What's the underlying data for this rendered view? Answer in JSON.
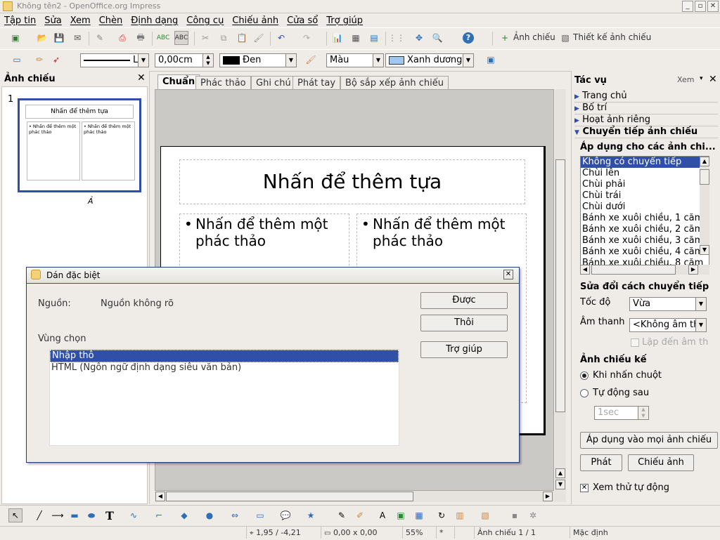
{
  "window": {
    "title": "Không tên2 - OpenOffice.org Impress"
  },
  "menu": [
    "Tập tin",
    "Sửa",
    "Xem",
    "Chèn",
    "Định dạng",
    "Công cụ",
    "Chiếu ảnh",
    "Cửa sổ",
    "Trợ giúp"
  ],
  "toolbar1": {
    "slideshow_label": "Ảnh chiếu",
    "design_label": "Thiết kế ảnh chiếu"
  },
  "toolbar2": {
    "line_style": "L",
    "line_width": "0,00cm",
    "line_color": "Đen",
    "area_style": "Màu",
    "area_color": "Xanh dương"
  },
  "slides_panel": {
    "title": "Ảnh chiếu",
    "slide_number": "1",
    "thumb_title": "Nhấn để thêm tựa",
    "thumb_outline": "• Nhấn để thêm một phác thảo",
    "thumb_caption": "Ả"
  },
  "tabs": [
    "Chuẩn",
    "Phác thảo",
    "Ghi chú",
    "Phát tay",
    "Bộ sắp xếp ảnh chiếu"
  ],
  "slide": {
    "title": "Nhấn để thêm tựa",
    "outline_left": "Nhấn để thêm một phác thảo",
    "outline_right": "Nhấn để thêm một phác thảo"
  },
  "tasks": {
    "title": "Tác vụ",
    "view_label": "Xem",
    "sections": [
      "Trang chủ",
      "Bố trí",
      "Hoạt ảnh riêng",
      "Chuyển tiếp ảnh chiếu"
    ],
    "apply_to_label": "Áp dụng cho các ảnh chi...",
    "transitions": [
      "Không có chuyển tiếp",
      "Chùi lên",
      "Chùi phải",
      "Chùi trái",
      "Chùi dưới",
      "Bánh xe xuôi chiều, 1 căm",
      "Bánh xe xuôi chiều, 2 căm",
      "Bánh xe xuôi chiều, 3 căm",
      "Bánh xe xuôi chiều, 4 căm",
      "Bánh xe xuôi chiều, 8 căm"
    ],
    "modify_label": "Sửa đổi cách chuyển tiếp",
    "speed_label": "Tốc độ",
    "speed_value": "Vừa",
    "sound_label": "Âm thanh",
    "sound_value": "<Không âm th",
    "loop_label": "Lặp đến âm th",
    "advance_label": "Ảnh chiếu kế",
    "on_click_label": "Khi nhấn chuột",
    "auto_after_label": "Tự động sau",
    "auto_after_value": "1sec",
    "apply_all_label": "Áp dụng vào mọi ảnh chiếu",
    "play_label": "Phát",
    "slideshow_label": "Chiếu ảnh",
    "preview_label": "Xem thử tự động"
  },
  "dialog": {
    "title": "Dán đặc biệt",
    "source_label": "Nguồn:",
    "source_value": "Nguồn không rõ",
    "selection_label": "Vùng chọn",
    "options": [
      "Nhập thô",
      "HTML (Ngôn ngữ định dạng siêu văn bản)"
    ],
    "ok_label": "Được",
    "cancel_label": "Thôi",
    "help_label": "Trợ giúp"
  },
  "statusbar": {
    "position": "1,95 / -4,21",
    "size": "0,00 x 0,00",
    "zoom": "55%",
    "modified": "*",
    "slide_info": "Ảnh chiếu 1 / 1",
    "layout": "Mặc định"
  },
  "colors": {
    "selection": "#2f4fa8",
    "dialog_title": "#2f4fa8",
    "canvas": "#cbc9c6",
    "slide_border": "#000000"
  }
}
